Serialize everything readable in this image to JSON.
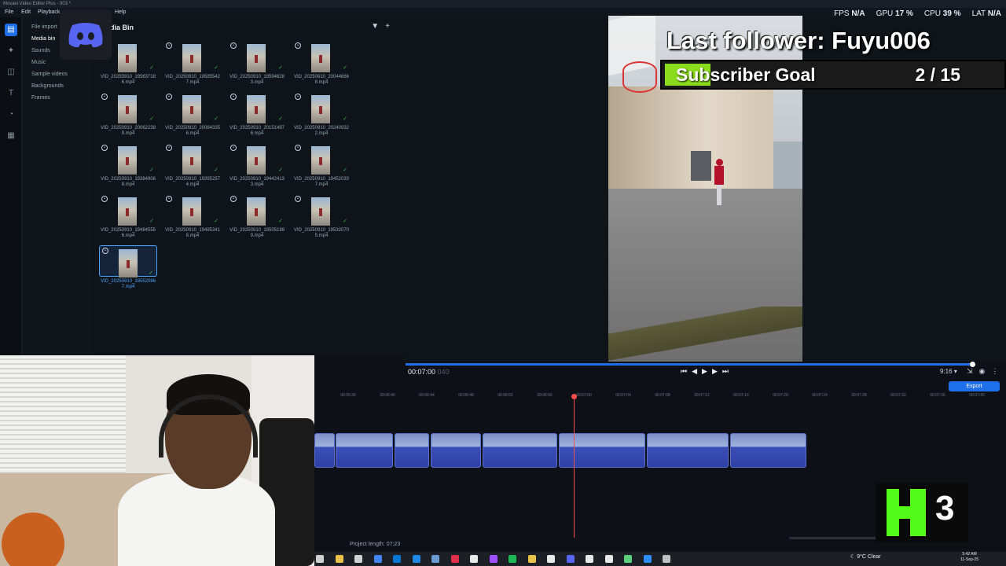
{
  "titlebar": {
    "title": "Movavi Video Editor Plus - 003 *"
  },
  "menu": [
    {
      "label": "File"
    },
    {
      "label": "Edit"
    },
    {
      "label": "Playback"
    },
    {
      "label": "Help"
    }
  ],
  "stats": {
    "fps_label": "FPS",
    "fps_value": "N/A",
    "gpu_label": "GPU",
    "gpu_value": "17 %",
    "cpu_label": "CPU",
    "cpu_value": "39 %",
    "lat_label": "LAT",
    "lat_value": "N/A"
  },
  "rail_icons": [
    "import-icon",
    "magic-wand-icon",
    "transitions-icon",
    "titles-icon",
    "stickers-icon",
    "more-tools-icon"
  ],
  "categories": [
    {
      "label": "File import",
      "active": false
    },
    {
      "label": "Media bin",
      "active": true
    },
    {
      "label": "Sounds",
      "active": false
    },
    {
      "label": "Music",
      "active": false
    },
    {
      "label": "Sample videos",
      "active": false
    },
    {
      "label": "Backgrounds",
      "active": false
    },
    {
      "label": "Frames",
      "active": false
    }
  ],
  "bin": {
    "title": "dia Bin",
    "clips": [
      {
        "name": "VID_20250910_195637186.mp4"
      },
      {
        "name": "VID_20250910_195855427.mp4"
      },
      {
        "name": "VID_20250910_195948283.mp4"
      },
      {
        "name": "VID_20250910_200446668.mp4"
      },
      {
        "name": "VID_20250910_200622399.mp4"
      },
      {
        "name": "VID_20250910_200843356.mp4"
      },
      {
        "name": "VID_20250910_201514976.mp4"
      },
      {
        "name": "VID_20250910_202409322.mp4"
      },
      {
        "name": "VID_20250910_193849068.mp4"
      },
      {
        "name": "VID_20250910_193952574.mp4"
      },
      {
        "name": "VID_20250910_194424133.mp4"
      },
      {
        "name": "VID_20250910_194520337.mp4"
      },
      {
        "name": "VID_20250910_194845556.mp4"
      },
      {
        "name": "VID_20250910_194953418.mp4"
      },
      {
        "name": "VID_20250910_195051999.mp4"
      },
      {
        "name": "VID_20250910_195320705.mp4"
      },
      {
        "name": "VID_20250910_195520867.mp4",
        "selected": true
      }
    ]
  },
  "overlay": {
    "follower_text": "Last follower: Fuyu006",
    "goal_label": "Subscriber Goal",
    "goal_count": "2 / 15",
    "goal_current": 2,
    "goal_total": 15
  },
  "player": {
    "timecode": "00:07:00",
    "timecode_frames": "040",
    "aspect_ratio": "9:16",
    "progress": 1.0
  },
  "timeline": {
    "export_label": "Export",
    "ruler_ticks": [
      "00:06:36",
      "00:06:40",
      "00:06:44",
      "00:06:48",
      "00:06:52",
      "00:06:56",
      "00:07:00",
      "00:07:04",
      "00:07:08",
      "00:07:12",
      "00:07:16",
      "00:07:20",
      "00:07:24",
      "00:07:28",
      "00:07:32",
      "00:07:36",
      "00:07:40"
    ],
    "project_length": "Project length: 07:23"
  },
  "kick": {
    "count": "3"
  },
  "taskbar": {
    "weather": "9°C  Clear",
    "time": "5:42 AM",
    "date": "11-Sep-25"
  },
  "colors": {
    "accent": "#1f6feb",
    "goal_fill": "#8bdc1c",
    "kick_green": "#53fc18",
    "playhead": "#ff4d4d"
  }
}
